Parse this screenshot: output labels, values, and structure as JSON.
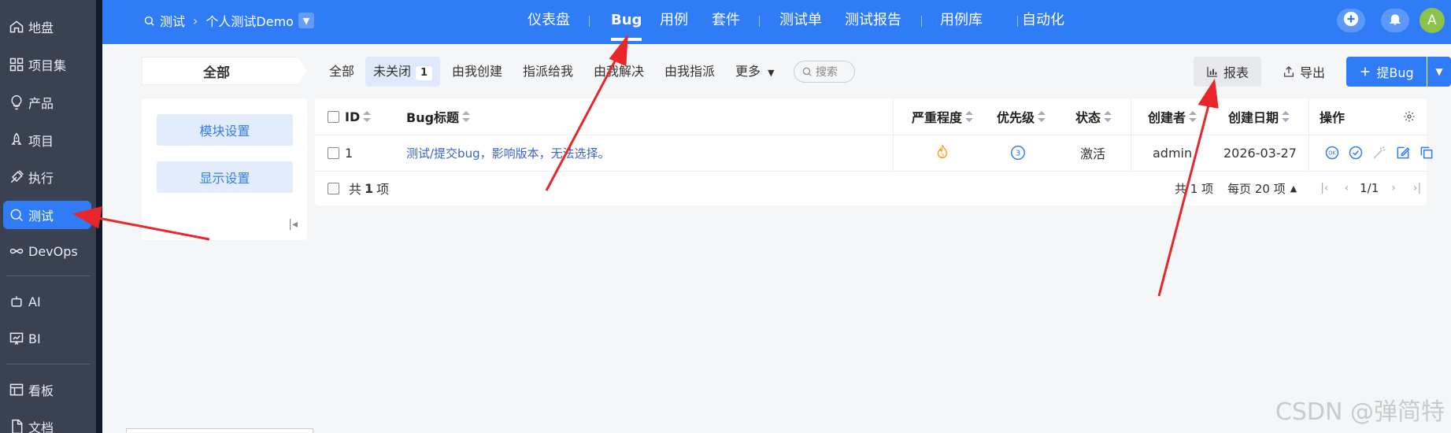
{
  "sidebar": {
    "items": [
      {
        "label": "地盘",
        "icon": "home-icon"
      },
      {
        "label": "项目集",
        "icon": "grid-icon"
      },
      {
        "label": "产品",
        "icon": "bulb-icon"
      },
      {
        "label": "项目",
        "icon": "rocket-icon"
      },
      {
        "label": "执行",
        "icon": "run-icon"
      },
      {
        "label": "测试",
        "icon": "test-icon",
        "active": true
      },
      {
        "label": "DevOps",
        "icon": "infinity-icon"
      },
      {
        "label": "AI",
        "icon": "robot-icon"
      },
      {
        "label": "BI",
        "icon": "chart-icon"
      },
      {
        "label": "看板",
        "icon": "board-icon"
      },
      {
        "label": "文档",
        "icon": "doc-icon"
      }
    ]
  },
  "topbar": {
    "breadcrumb_module": "测试",
    "breadcrumb_project": "个人测试Demo",
    "nav": [
      "仪表盘",
      "Bug",
      "用例",
      "套件",
      "测试单",
      "测试报告",
      "用例库",
      "自动化"
    ],
    "active_nav": "Bug",
    "avatar_letter": "A"
  },
  "filters": {
    "all_tab": "全部",
    "tabs": [
      "全部",
      "未关闭",
      "由我创建",
      "指派给我",
      "由我解决",
      "由我指派",
      "更多"
    ],
    "unclosed_count": "1",
    "search_label": "搜索",
    "report_label": "报表",
    "export_label": "导出",
    "add_bug_label": "提Bug"
  },
  "left_panel": {
    "module_settings": "模块设置",
    "display_settings": "显示设置"
  },
  "table": {
    "columns": [
      "ID",
      "Bug标题",
      "严重程度",
      "优先级",
      "状态",
      "创建者",
      "创建日期",
      "操作"
    ],
    "rows": [
      {
        "id": "1",
        "title": "测试/提交bug，影响版本，无法选择。",
        "severity": "3",
        "priority": "3",
        "status": "激活",
        "creator": "admin",
        "date": "2026-03-27"
      }
    ],
    "footer_total_prefix": "共",
    "footer_total_count": "1",
    "footer_total_suffix": "项",
    "pager_total": "共 1 项",
    "per_page": "每页 20 项",
    "page_indicator": "1/1"
  },
  "watermark": "CSDN @弹简特",
  "colors": {
    "primary": "#2f7cf6",
    "sidebar": "#3a4150",
    "arrow": "#e8262b",
    "severity": "#f5a623"
  }
}
